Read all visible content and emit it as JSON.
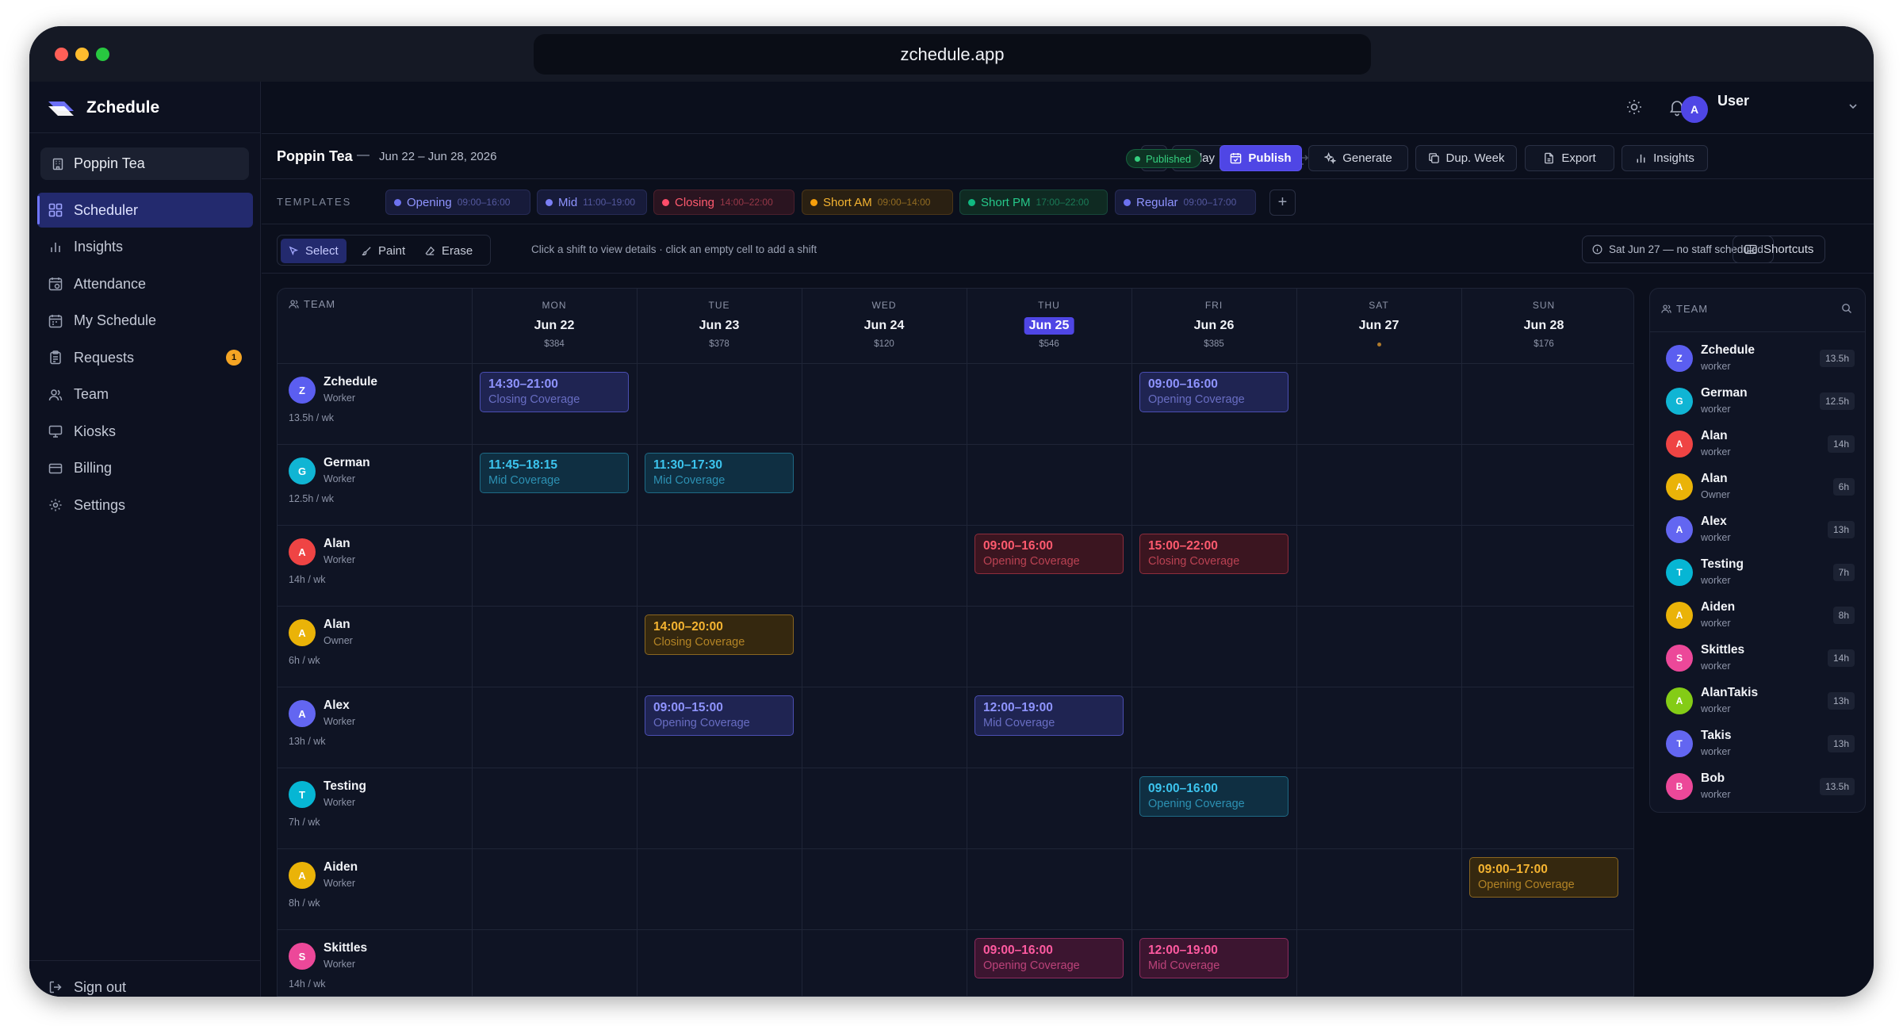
{
  "browser": {
    "url": "zchedule.app"
  },
  "brand": {
    "name": "Zchedule"
  },
  "org": {
    "name": "Poppin Tea"
  },
  "nav": [
    {
      "label": "Scheduler",
      "icon": "grid-icon",
      "active": true
    },
    {
      "label": "Insights",
      "icon": "bar-chart-icon"
    },
    {
      "label": "Attendance",
      "icon": "calendar-clock-icon"
    },
    {
      "label": "My Schedule",
      "icon": "calendar-icon"
    },
    {
      "label": "Requests",
      "icon": "clipboard-icon",
      "badge": "1"
    },
    {
      "label": "Team",
      "icon": "users-icon"
    },
    {
      "label": "Kiosks",
      "icon": "monitor-icon"
    },
    {
      "label": "Billing",
      "icon": "credit-card-icon"
    },
    {
      "label": "Settings",
      "icon": "gear-icon"
    }
  ],
  "signout": {
    "label": "Sign out"
  },
  "topbar": {
    "user_name": "User",
    "user_initial": "A"
  },
  "toolbar": {
    "store": "Poppin Tea",
    "separator": "—",
    "range": "Jun 22 – Jun 28, 2026",
    "today": "Today",
    "status": "Published",
    "publish": "Publish",
    "generate": "Generate",
    "dup_week": "Dup. Week",
    "export": "Export",
    "insights": "Insights"
  },
  "templates": {
    "label": "TEMPLATES",
    "items": [
      {
        "name": "Opening",
        "time": "09:00–16:00",
        "color": "#6d72f0"
      },
      {
        "name": "Mid",
        "time": "11:00–19:00",
        "color": "#7b7ff5"
      },
      {
        "name": "Closing",
        "time": "14:00–22:00",
        "color": "#ff4d6a"
      },
      {
        "name": "Short AM",
        "time": "09:00–14:00",
        "color": "#f59e0b"
      },
      {
        "name": "Short PM",
        "time": "17:00–22:00",
        "color": "#10b981"
      },
      {
        "name": "Regular",
        "time": "09:00–17:00",
        "color": "#6d72f0"
      }
    ]
  },
  "modes": {
    "select": "Select",
    "paint": "Paint",
    "erase": "Erase"
  },
  "hint": "Click a shift to view details · click an empty cell to add a shift",
  "no_staff": "Sat Jun 27 — no staff scheduled",
  "shortcuts": "Shortcuts",
  "grid": {
    "team_header": "TEAM",
    "days": [
      {
        "dow": "MON",
        "date": "Jun 22",
        "cost": "$384"
      },
      {
        "dow": "TUE",
        "date": "Jun 23",
        "cost": "$378"
      },
      {
        "dow": "WED",
        "date": "Jun 24",
        "cost": "$120"
      },
      {
        "dow": "THU",
        "date": "Jun 25",
        "cost": "$546",
        "today": true
      },
      {
        "dow": "FRI",
        "date": "Jun 26",
        "cost": "$385"
      },
      {
        "dow": "SAT",
        "date": "Jun 27",
        "cost": ""
      },
      {
        "dow": "SUN",
        "date": "Jun 28",
        "cost": "$176"
      }
    ],
    "employees": [
      {
        "name": "Zchedule",
        "role": "Worker",
        "hours": "13.5h / wk",
        "initial": "Z",
        "color": "#5b5ef0"
      },
      {
        "name": "German",
        "role": "Worker",
        "hours": "12.5h / wk",
        "initial": "G",
        "color": "#10b5d4"
      },
      {
        "name": "Alan",
        "role": "Worker",
        "hours": "14h / wk",
        "initial": "A",
        "color": "#ef4444"
      },
      {
        "name": "Alan",
        "role": "Owner",
        "hours": "6h / wk",
        "initial": "A",
        "color": "#eab308"
      },
      {
        "name": "Alex",
        "role": "Worker",
        "hours": "13h / wk",
        "initial": "A",
        "color": "#6366f1"
      },
      {
        "name": "Testing",
        "role": "Worker",
        "hours": "7h / wk",
        "initial": "T",
        "color": "#06b6d4"
      },
      {
        "name": "Aiden",
        "role": "Worker",
        "hours": "8h / wk",
        "initial": "A",
        "color": "#eab308"
      },
      {
        "name": "Skittles",
        "role": "Worker",
        "hours": "14h / wk",
        "initial": "S",
        "color": "#ec4899"
      }
    ],
    "shifts": [
      {
        "row": 0,
        "day": 0,
        "time": "14:30–21:00",
        "label": "Closing Coverage",
        "style": "purple"
      },
      {
        "row": 0,
        "day": 4,
        "time": "09:00–16:00",
        "label": "Opening Coverage",
        "style": "purple"
      },
      {
        "row": 1,
        "day": 0,
        "time": "11:45–18:15",
        "label": "Mid Coverage",
        "style": "cyan"
      },
      {
        "row": 1,
        "day": 1,
        "time": "11:30–17:30",
        "label": "Mid Coverage",
        "style": "cyan"
      },
      {
        "row": 2,
        "day": 3,
        "time": "09:00–16:00",
        "label": "Opening Coverage",
        "style": "red"
      },
      {
        "row": 2,
        "day": 4,
        "time": "15:00–22:00",
        "label": "Closing Coverage",
        "style": "red"
      },
      {
        "row": 3,
        "day": 1,
        "time": "14:00–20:00",
        "label": "Closing Coverage",
        "style": "amber"
      },
      {
        "row": 4,
        "day": 1,
        "time": "09:00–15:00",
        "label": "Opening Coverage",
        "style": "purple"
      },
      {
        "row": 4,
        "day": 3,
        "time": "12:00–19:00",
        "label": "Mid Coverage",
        "style": "purple"
      },
      {
        "row": 5,
        "day": 4,
        "time": "09:00–16:00",
        "label": "Opening Coverage",
        "style": "cyan"
      },
      {
        "row": 6,
        "day": 6,
        "time": "09:00–17:00",
        "label": "Opening Coverage",
        "style": "amber"
      },
      {
        "row": 7,
        "day": 3,
        "time": "09:00–16:00",
        "label": "Opening Coverage",
        "style": "pink"
      },
      {
        "row": 7,
        "day": 4,
        "time": "12:00–19:00",
        "label": "Mid Coverage",
        "style": "pink"
      }
    ]
  },
  "team_panel": {
    "header": "TEAM",
    "members": [
      {
        "name": "Zchedule",
        "role": "worker",
        "hours": "13.5h",
        "initial": "Z",
        "color": "#5b5ef0"
      },
      {
        "name": "German",
        "role": "worker",
        "hours": "12.5h",
        "initial": "G",
        "color": "#10b5d4"
      },
      {
        "name": "Alan",
        "role": "worker",
        "hours": "14h",
        "initial": "A",
        "color": "#ef4444"
      },
      {
        "name": "Alan",
        "role": "Owner",
        "hours": "6h",
        "initial": "A",
        "color": "#eab308"
      },
      {
        "name": "Alex",
        "role": "worker",
        "hours": "13h",
        "initial": "A",
        "color": "#6366f1"
      },
      {
        "name": "Testing",
        "role": "worker",
        "hours": "7h",
        "initial": "T",
        "color": "#06b6d4"
      },
      {
        "name": "Aiden",
        "role": "worker",
        "hours": "8h",
        "initial": "A",
        "color": "#eab308"
      },
      {
        "name": "Skittles",
        "role": "worker",
        "hours": "14h",
        "initial": "S",
        "color": "#ec4899"
      },
      {
        "name": "AlanTakis",
        "role": "worker",
        "hours": "13h",
        "initial": "A",
        "color": "#84cc16"
      },
      {
        "name": "Takis",
        "role": "worker",
        "hours": "13h",
        "initial": "T",
        "color": "#6366f1"
      },
      {
        "name": "Bob",
        "role": "worker",
        "hours": "13.5h",
        "initial": "B",
        "color": "#ec4899"
      }
    ]
  }
}
